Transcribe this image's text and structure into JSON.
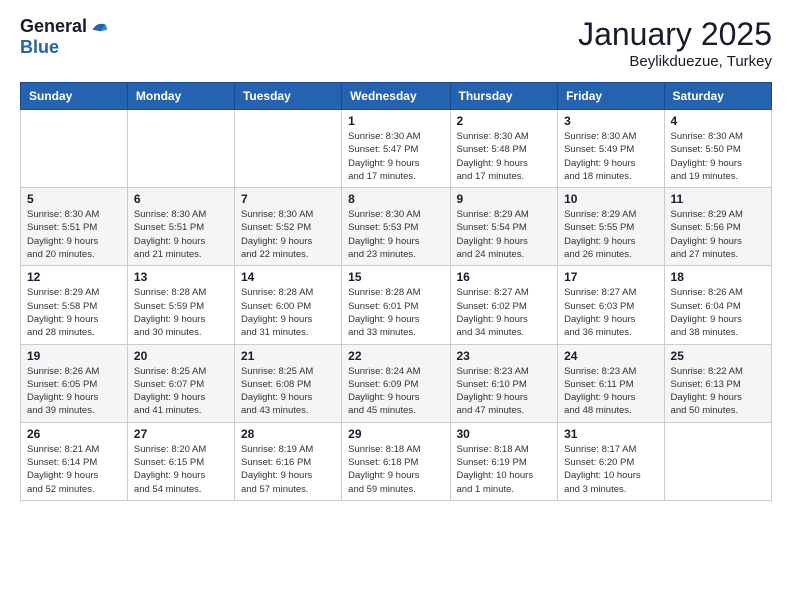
{
  "logo": {
    "general": "General",
    "blue": "Blue"
  },
  "header": {
    "month": "January 2025",
    "location": "Beylikduezue, Turkey"
  },
  "days_of_week": [
    "Sunday",
    "Monday",
    "Tuesday",
    "Wednesday",
    "Thursday",
    "Friday",
    "Saturday"
  ],
  "weeks": [
    [
      {
        "day": "",
        "info": ""
      },
      {
        "day": "",
        "info": ""
      },
      {
        "day": "",
        "info": ""
      },
      {
        "day": "1",
        "info": "Sunrise: 8:30 AM\nSunset: 5:47 PM\nDaylight: 9 hours\nand 17 minutes."
      },
      {
        "day": "2",
        "info": "Sunrise: 8:30 AM\nSunset: 5:48 PM\nDaylight: 9 hours\nand 17 minutes."
      },
      {
        "day": "3",
        "info": "Sunrise: 8:30 AM\nSunset: 5:49 PM\nDaylight: 9 hours\nand 18 minutes."
      },
      {
        "day": "4",
        "info": "Sunrise: 8:30 AM\nSunset: 5:50 PM\nDaylight: 9 hours\nand 19 minutes."
      }
    ],
    [
      {
        "day": "5",
        "info": "Sunrise: 8:30 AM\nSunset: 5:51 PM\nDaylight: 9 hours\nand 20 minutes."
      },
      {
        "day": "6",
        "info": "Sunrise: 8:30 AM\nSunset: 5:51 PM\nDaylight: 9 hours\nand 21 minutes."
      },
      {
        "day": "7",
        "info": "Sunrise: 8:30 AM\nSunset: 5:52 PM\nDaylight: 9 hours\nand 22 minutes."
      },
      {
        "day": "8",
        "info": "Sunrise: 8:30 AM\nSunset: 5:53 PM\nDaylight: 9 hours\nand 23 minutes."
      },
      {
        "day": "9",
        "info": "Sunrise: 8:29 AM\nSunset: 5:54 PM\nDaylight: 9 hours\nand 24 minutes."
      },
      {
        "day": "10",
        "info": "Sunrise: 8:29 AM\nSunset: 5:55 PM\nDaylight: 9 hours\nand 26 minutes."
      },
      {
        "day": "11",
        "info": "Sunrise: 8:29 AM\nSunset: 5:56 PM\nDaylight: 9 hours\nand 27 minutes."
      }
    ],
    [
      {
        "day": "12",
        "info": "Sunrise: 8:29 AM\nSunset: 5:58 PM\nDaylight: 9 hours\nand 28 minutes."
      },
      {
        "day": "13",
        "info": "Sunrise: 8:28 AM\nSunset: 5:59 PM\nDaylight: 9 hours\nand 30 minutes."
      },
      {
        "day": "14",
        "info": "Sunrise: 8:28 AM\nSunset: 6:00 PM\nDaylight: 9 hours\nand 31 minutes."
      },
      {
        "day": "15",
        "info": "Sunrise: 8:28 AM\nSunset: 6:01 PM\nDaylight: 9 hours\nand 33 minutes."
      },
      {
        "day": "16",
        "info": "Sunrise: 8:27 AM\nSunset: 6:02 PM\nDaylight: 9 hours\nand 34 minutes."
      },
      {
        "day": "17",
        "info": "Sunrise: 8:27 AM\nSunset: 6:03 PM\nDaylight: 9 hours\nand 36 minutes."
      },
      {
        "day": "18",
        "info": "Sunrise: 8:26 AM\nSunset: 6:04 PM\nDaylight: 9 hours\nand 38 minutes."
      }
    ],
    [
      {
        "day": "19",
        "info": "Sunrise: 8:26 AM\nSunset: 6:05 PM\nDaylight: 9 hours\nand 39 minutes."
      },
      {
        "day": "20",
        "info": "Sunrise: 8:25 AM\nSunset: 6:07 PM\nDaylight: 9 hours\nand 41 minutes."
      },
      {
        "day": "21",
        "info": "Sunrise: 8:25 AM\nSunset: 6:08 PM\nDaylight: 9 hours\nand 43 minutes."
      },
      {
        "day": "22",
        "info": "Sunrise: 8:24 AM\nSunset: 6:09 PM\nDaylight: 9 hours\nand 45 minutes."
      },
      {
        "day": "23",
        "info": "Sunrise: 8:23 AM\nSunset: 6:10 PM\nDaylight: 9 hours\nand 47 minutes."
      },
      {
        "day": "24",
        "info": "Sunrise: 8:23 AM\nSunset: 6:11 PM\nDaylight: 9 hours\nand 48 minutes."
      },
      {
        "day": "25",
        "info": "Sunrise: 8:22 AM\nSunset: 6:13 PM\nDaylight: 9 hours\nand 50 minutes."
      }
    ],
    [
      {
        "day": "26",
        "info": "Sunrise: 8:21 AM\nSunset: 6:14 PM\nDaylight: 9 hours\nand 52 minutes."
      },
      {
        "day": "27",
        "info": "Sunrise: 8:20 AM\nSunset: 6:15 PM\nDaylight: 9 hours\nand 54 minutes."
      },
      {
        "day": "28",
        "info": "Sunrise: 8:19 AM\nSunset: 6:16 PM\nDaylight: 9 hours\nand 57 minutes."
      },
      {
        "day": "29",
        "info": "Sunrise: 8:18 AM\nSunset: 6:18 PM\nDaylight: 9 hours\nand 59 minutes."
      },
      {
        "day": "30",
        "info": "Sunrise: 8:18 AM\nSunset: 6:19 PM\nDaylight: 10 hours\nand 1 minute."
      },
      {
        "day": "31",
        "info": "Sunrise: 8:17 AM\nSunset: 6:20 PM\nDaylight: 10 hours\nand 3 minutes."
      },
      {
        "day": "",
        "info": ""
      }
    ]
  ]
}
